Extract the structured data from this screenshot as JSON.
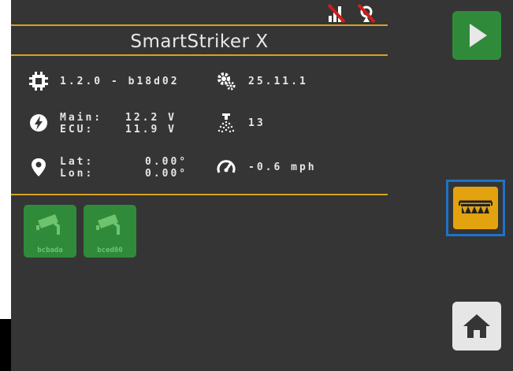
{
  "header": {
    "title": "SmartStriker X",
    "status_icons": [
      "no-network-icon",
      "no-gps-icon"
    ]
  },
  "info": {
    "firmware": "1.2.0 - b18d02",
    "version": "25.11.1",
    "voltage_labels": "Main:\nECU:",
    "voltage_values": "12.2 V\n11.9 V",
    "spray_count": "13",
    "coord_labels": "Lat:\nLon:",
    "coord_values": "0.00°\n0.00°",
    "speed": "-0.6 mph"
  },
  "cameras": [
    {
      "label": "bcbada",
      "icon": "camera-icon"
    },
    {
      "label": "bced00",
      "icon": "camera-icon"
    }
  ],
  "side_buttons": {
    "play": "play-icon",
    "boom": "sprayer-boom-icon",
    "home": "home-icon"
  },
  "colors": {
    "background": "#353535",
    "accent": "#d7a21e",
    "green": "#2f8b3a",
    "boom_button": "#e3a30f",
    "selection": "#1e73c8"
  }
}
